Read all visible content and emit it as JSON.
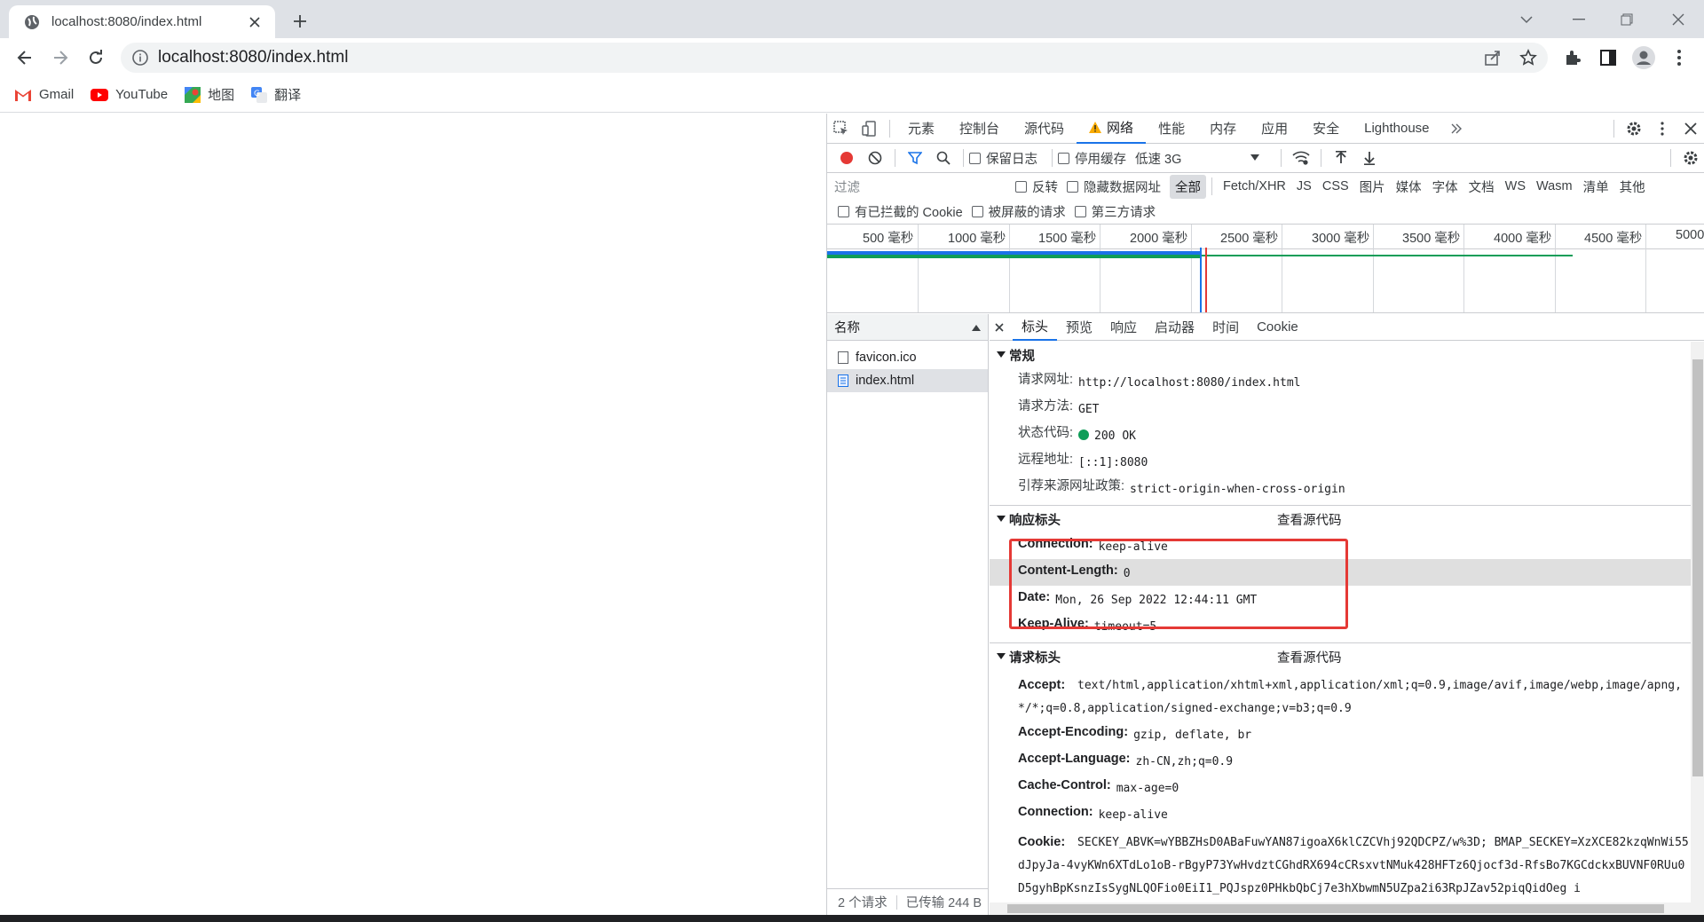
{
  "browser": {
    "tab_title": "localhost:8080/index.html",
    "url": "localhost:8080/index.html",
    "bookmarks": [
      {
        "label": "Gmail",
        "icon": "gmail-icon"
      },
      {
        "label": "YouTube",
        "icon": "youtube-icon"
      },
      {
        "label": "地图",
        "icon": "maps-icon"
      },
      {
        "label": "翻译",
        "icon": "translate-icon"
      }
    ]
  },
  "devtools": {
    "tabs": [
      "元素",
      "控制台",
      "源代码",
      "网络",
      "性能",
      "内存",
      "应用",
      "安全",
      "Lighthouse"
    ],
    "active_tab": "网络",
    "toolbar": {
      "preserve_log": "保留日志",
      "disable_cache": "停用缓存",
      "throttle": "低速 3G"
    },
    "filter": {
      "placeholder": "过滤",
      "invert": "反转",
      "hide_data_urls": "隐藏数据网址",
      "types": [
        "全部",
        "Fetch/XHR",
        "JS",
        "CSS",
        "图片",
        "媒体",
        "字体",
        "文档",
        "WS",
        "Wasm",
        "清单",
        "其他"
      ],
      "selected_type": "全部",
      "blocked_cookies": "有已拦截的 Cookie",
      "blocked_requests": "被屏蔽的请求",
      "third_party": "第三方请求"
    },
    "timeline_ticks": [
      "500 毫秒",
      "1000 毫秒",
      "1500 毫秒",
      "2000 毫秒",
      "2500 毫秒",
      "3000 毫秒",
      "3500 毫秒",
      "4000 毫秒",
      "4500 毫秒",
      "5000"
    ],
    "request_list": {
      "header": "名称",
      "items": [
        "favicon.ico",
        "index.html"
      ],
      "selected": "index.html",
      "status_count": "2 个请求",
      "status_transferred": "已传输 244 B"
    },
    "details": {
      "tabs": [
        "标头",
        "预览",
        "响应",
        "启动器",
        "时间",
        "Cookie"
      ],
      "active_tab": "标头",
      "general": {
        "title": "常规",
        "rows": [
          {
            "k": "请求网址:",
            "v": "http://localhost:8080/index.html"
          },
          {
            "k": "请求方法:",
            "v": "GET"
          },
          {
            "k": "状态代码:",
            "v": "200 OK"
          },
          {
            "k": "远程地址:",
            "v": "[::1]:8080"
          },
          {
            "k": "引荐来源网址政策:",
            "v": "strict-origin-when-cross-origin"
          }
        ]
      },
      "response_headers": {
        "title": "响应标头",
        "view_source": "查看源代码",
        "rows": [
          {
            "k": "Connection:",
            "v": "keep-alive"
          },
          {
            "k": "Content-Length:",
            "v": "0"
          },
          {
            "k": "Date:",
            "v": "Mon, 26 Sep 2022 12:44:11 GMT"
          },
          {
            "k": "Keep-Alive:",
            "v": "timeout=5"
          }
        ]
      },
      "request_headers": {
        "title": "请求标头",
        "view_source": "查看源代码",
        "rows": [
          {
            "k": "Accept:",
            "v": "text/html,application/xhtml+xml,application/xml;q=0.9,image/avif,image/webp,image/apng,*/*;q=0.8,application/signed-exchange;v=b3;q=0.9"
          },
          {
            "k": "Accept-Encoding:",
            "v": "gzip, deflate, br"
          },
          {
            "k": "Accept-Language:",
            "v": "zh-CN,zh;q=0.9"
          },
          {
            "k": "Cache-Control:",
            "v": "max-age=0"
          },
          {
            "k": "Connection:",
            "v": "keep-alive"
          },
          {
            "k": "Cookie:",
            "v": "SECKEY_ABVK=wYBBZHsD0ABaFuwYAN87igoaX6klCZCVhj92QDCPZ/w%3D; BMAP_SECKEY=XzXCE82kzqWnWi55dJpyJa-4vyKWn6XTdLo1oB-rBgyP73YwHvdztCGhdRX694cCRsxvtNMuk428HFTz6Qjocf3d-RfsBo7KGCdckxBUVNF0RUu0D5gyhBpKsnzIsSygNLQOFio0EiI1_PQJspz0PHkbQbCj7e3hXbwmN5UZpa2i63RpJZav52piqQidOeg i"
          }
        ]
      }
    }
  },
  "colors": {
    "accent": "#1a73e8",
    "record": "#e53935",
    "status_ok": "#0f9d58",
    "highlight_box": "#e53935"
  }
}
